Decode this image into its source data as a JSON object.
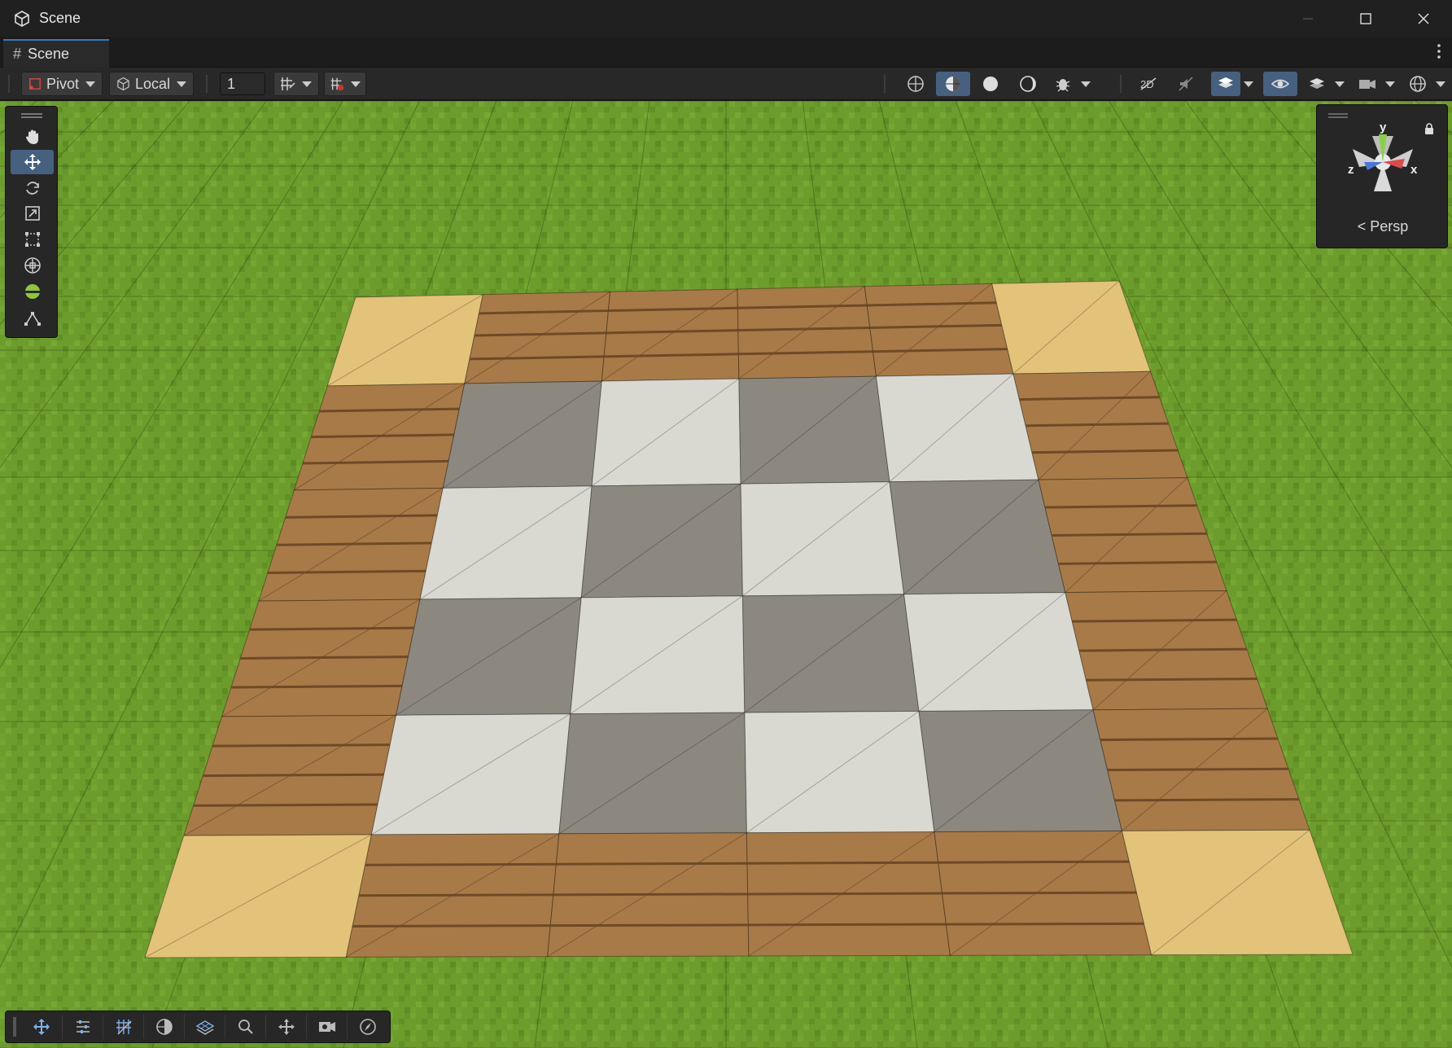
{
  "window": {
    "title": "Scene",
    "app_icon": "unity-cube-icon",
    "controls": [
      "minimize-icon",
      "maximize-icon",
      "close-icon"
    ]
  },
  "tabs": [
    {
      "label": "Scene",
      "icon": "grid-hash-icon",
      "active": true
    }
  ],
  "toolbar": {
    "pivot_label": "Pivot",
    "local_label": "Local",
    "snap_increment": "1",
    "right_icons": [
      "2d-wire-globe-icon",
      "shaded-wire-globe-icon",
      "sphere-solid-icon",
      "sphere-half-icon",
      "debug-bug-icon",
      "lighting-off-icon",
      "audio-off-icon",
      "gizmo-layers-icon",
      "visibility-eye-icon",
      "layers-icon",
      "camera-icon",
      "global-gizmo-icon"
    ]
  },
  "tools": [
    "hand-icon",
    "move-icon",
    "rotate-icon",
    "scale-icon",
    "rect-icon",
    "transform-icon",
    "custom-tool-sphere-icon",
    "path-tool-icon"
  ],
  "gizmo": {
    "axis_y": "y",
    "axis_x": "x",
    "axis_z": "z",
    "projection_label": "Persp",
    "back_glyph": "<"
  },
  "bottom_tools": [
    "move-icon",
    "sliders-icon",
    "grid-snap-icon",
    "globe-icon",
    "layers-grid-icon",
    "search-icon",
    "pivot-icon",
    "camera-icon",
    "compass-icon"
  ],
  "colors": {
    "grass": "#6a9a2a",
    "grass_dark": "#5e8c24",
    "plank": "#a87a48",
    "plank_line": "#6e4a26",
    "sand": "#e3c27a",
    "stone_light": "#d9d9d2",
    "stone_dark": "#8c8880",
    "accent_blue": "#46607f",
    "tab_accent": "#3a79bb",
    "axis_x": "#e04848",
    "axis_y": "#8ad046",
    "axis_z": "#4a78d8"
  }
}
